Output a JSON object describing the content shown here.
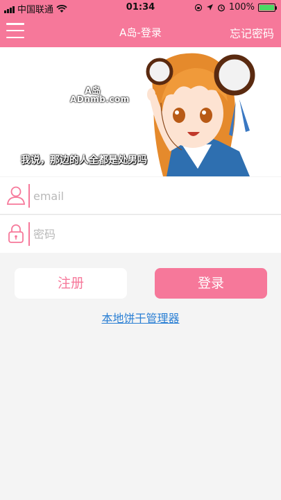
{
  "status_bar": {
    "carrier": "中国联通",
    "time": "01:34",
    "battery": "100%"
  },
  "nav": {
    "title": "A岛-登录",
    "forgot_label": "忘记密码"
  },
  "banner": {
    "brand_line1": "A岛",
    "brand_line2": "ADnmb.com",
    "caption": "我说，那边的人全都是处男吗"
  },
  "form": {
    "email_placeholder": "email",
    "password_placeholder": "密码"
  },
  "buttons": {
    "register_label": "注册",
    "login_label": "登录"
  },
  "links": {
    "cookie_manager": "本地饼干管理器"
  },
  "colors": {
    "accent": "#f6789a",
    "link": "#2a7fd4",
    "background": "#f4f4f4"
  }
}
